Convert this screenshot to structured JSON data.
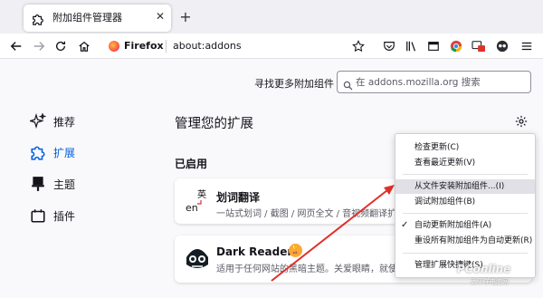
{
  "tab": {
    "title": "附加组件管理器",
    "close_glyph": "✕",
    "icon": "puzzle-piece-icon"
  },
  "new_tab_glyph": "+",
  "urlbar": {
    "identity": "Firefox",
    "url": "about:addons"
  },
  "findmore": {
    "label": "寻找更多附加组件",
    "placeholder": "在 addons.mozilla.org 搜索"
  },
  "sidebar": {
    "items": [
      {
        "label": "推荐",
        "icon": "sparkle-icon",
        "selected": false
      },
      {
        "label": "扩展",
        "icon": "puzzle-piece-icon",
        "selected": true
      },
      {
        "label": "主题",
        "icon": "paintbrush-icon",
        "selected": false
      },
      {
        "label": "插件",
        "icon": "plugin-icon",
        "selected": false
      }
    ]
  },
  "main": {
    "title": "管理您的扩展",
    "enabled_header": "已启用",
    "addons": [
      {
        "name": "划词翻译",
        "desc": "一站式划词 / 截图 / 网页全文 / 音视频翻译扩展",
        "icon_text": "英 en"
      },
      {
        "name": "Dark Reader",
        "desc": "适用于任何网站的黑暗主题。关爱眼睛，就使用 Dark Reader",
        "badge": "🏆"
      }
    ]
  },
  "menu": {
    "items": [
      {
        "label": "检查更新(C)"
      },
      {
        "label": "查看最近更新(V)"
      },
      {
        "label": "从文件安装附加组件...(I)"
      },
      {
        "label": "调试附加组件(B)"
      },
      {
        "label": "自动更新附加组件(A)",
        "checked": true
      },
      {
        "label": "重设所有附加组件为自动更新(R)"
      },
      {
        "label": "管理扩展快捷键(S)"
      }
    ]
  },
  "watermark": {
    "brand": "PConline",
    "sub": "太平洋电脑网"
  },
  "colors": {
    "accent": "#0061e0",
    "arrow": "#e0302a"
  }
}
